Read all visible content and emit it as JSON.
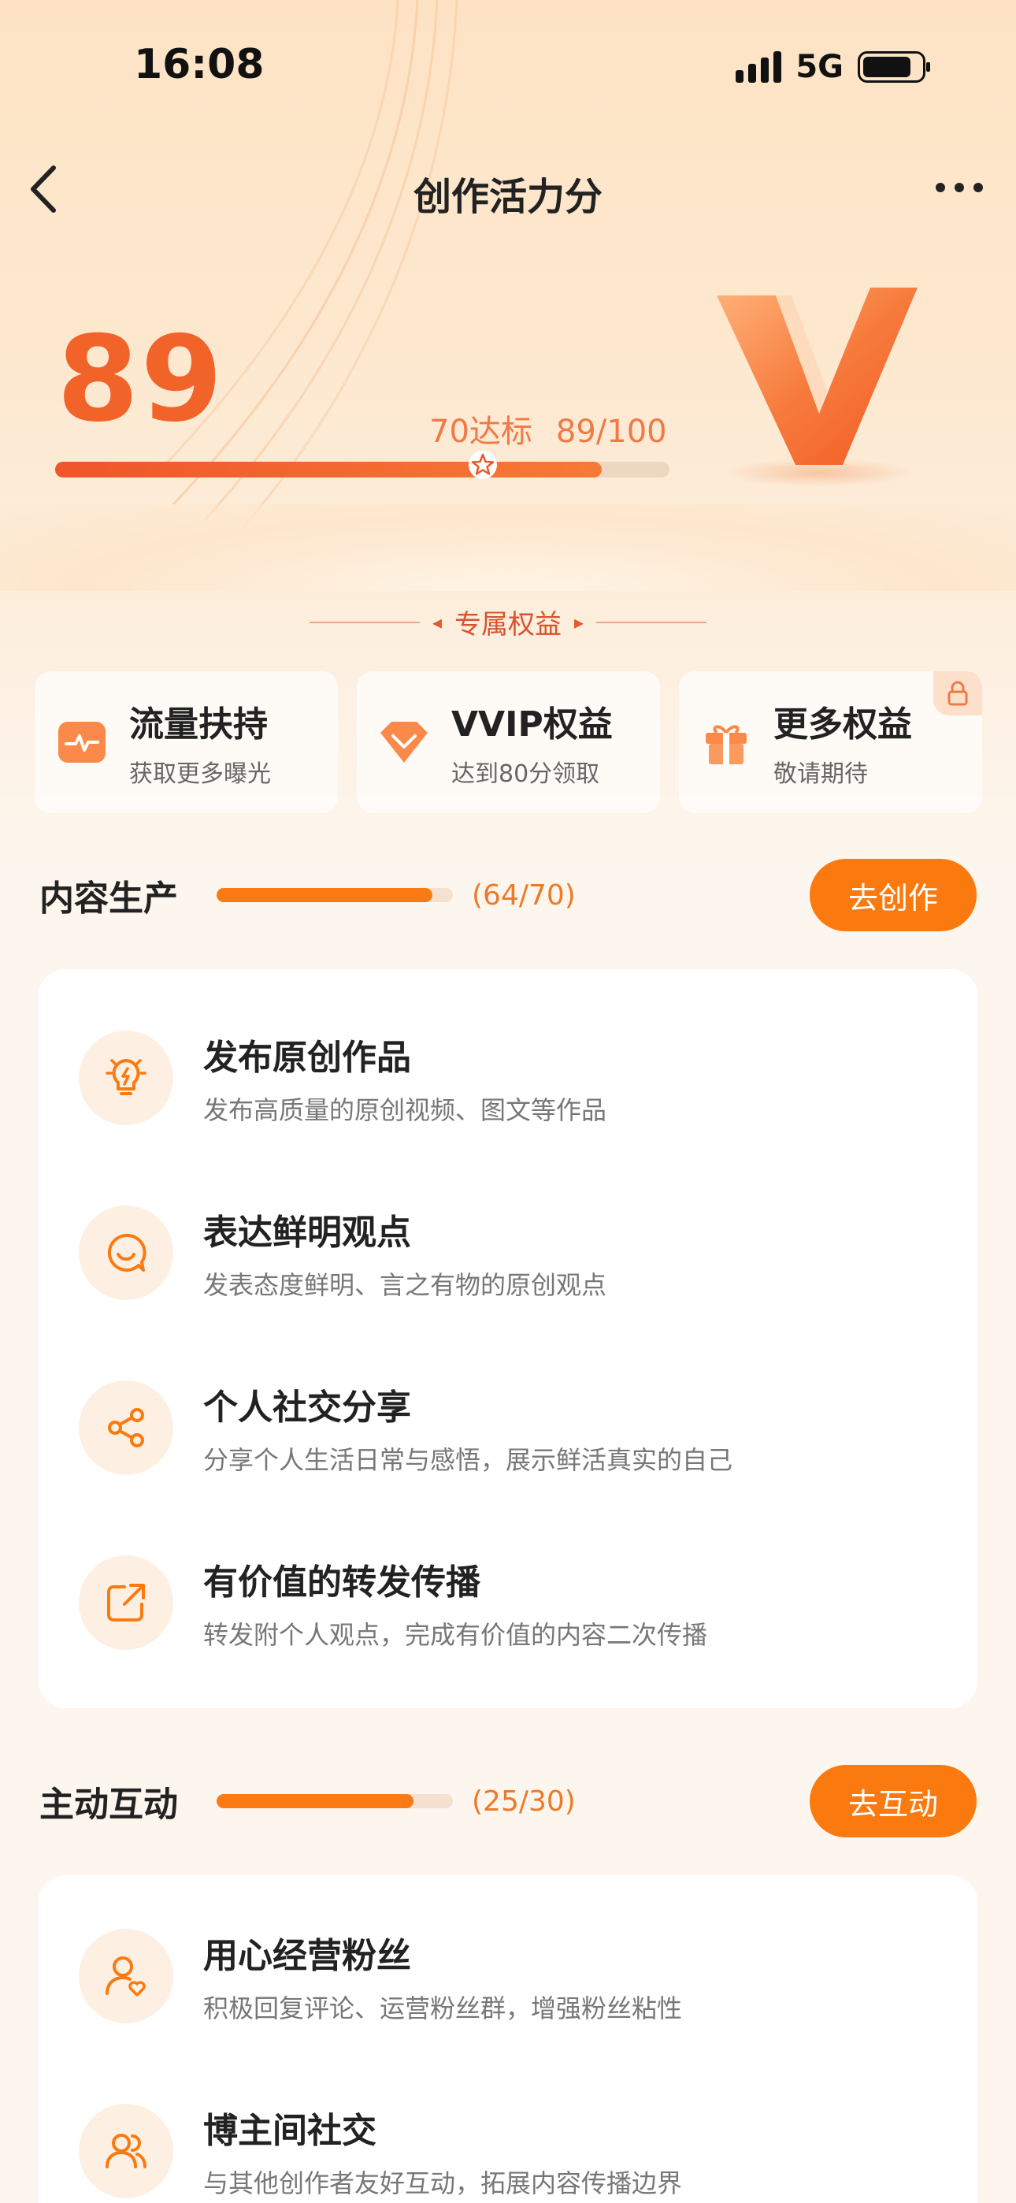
{
  "status_bar": {
    "time": "16:08",
    "network": "5G"
  },
  "nav": {
    "title": "创作活力分"
  },
  "score": {
    "value": "89",
    "target_label": "70达标",
    "progress_label": "89/100",
    "progress_fraction": 0.89,
    "target_fraction": 0.7,
    "accent_color": "#f2632a"
  },
  "benefits": {
    "section_label": "专属权益",
    "items": [
      {
        "title": "流量扶持",
        "subtitle": "获取更多曝光",
        "icon": "pulse-icon"
      },
      {
        "title": "VVIP权益",
        "subtitle": "达到80分领取",
        "icon": "diamond-icon"
      },
      {
        "title": "更多权益",
        "subtitle": "敬请期待",
        "icon": "gift-icon",
        "locked": true
      }
    ]
  },
  "content_section": {
    "title": "内容生产",
    "count": "(64/70)",
    "progress_fraction": 0.914,
    "button": "去创作",
    "items": [
      {
        "title": "发布原创作品",
        "desc": "发布高质量的原创视频、图文等作品",
        "icon": "lightbulb-icon"
      },
      {
        "title": "表达鲜明观点",
        "desc": "发表态度鲜明、言之有物的原创观点",
        "icon": "chat-smile-icon"
      },
      {
        "title": "个人社交分享",
        "desc": "分享个人生活日常与感悟，展示鲜活真实的自己",
        "icon": "share-icon"
      },
      {
        "title": "有价值的转发传播",
        "desc": "转发附个人观点，完成有价值的内容二次传播",
        "icon": "forward-icon"
      }
    ]
  },
  "interaction_section": {
    "title": "主动互动",
    "count": "(25/30)",
    "progress_fraction": 0.833,
    "button": "去互动",
    "items": [
      {
        "title": "用心经营粉丝",
        "desc": "积极回复评论、运营粉丝群，增强粉丝粘性",
        "icon": "user-heart-icon"
      },
      {
        "title": "博主间社交",
        "desc": "与其他创作者友好互动，拓展内容传播边界",
        "icon": "users-icon"
      }
    ]
  },
  "brand_color": "#fb7a10"
}
